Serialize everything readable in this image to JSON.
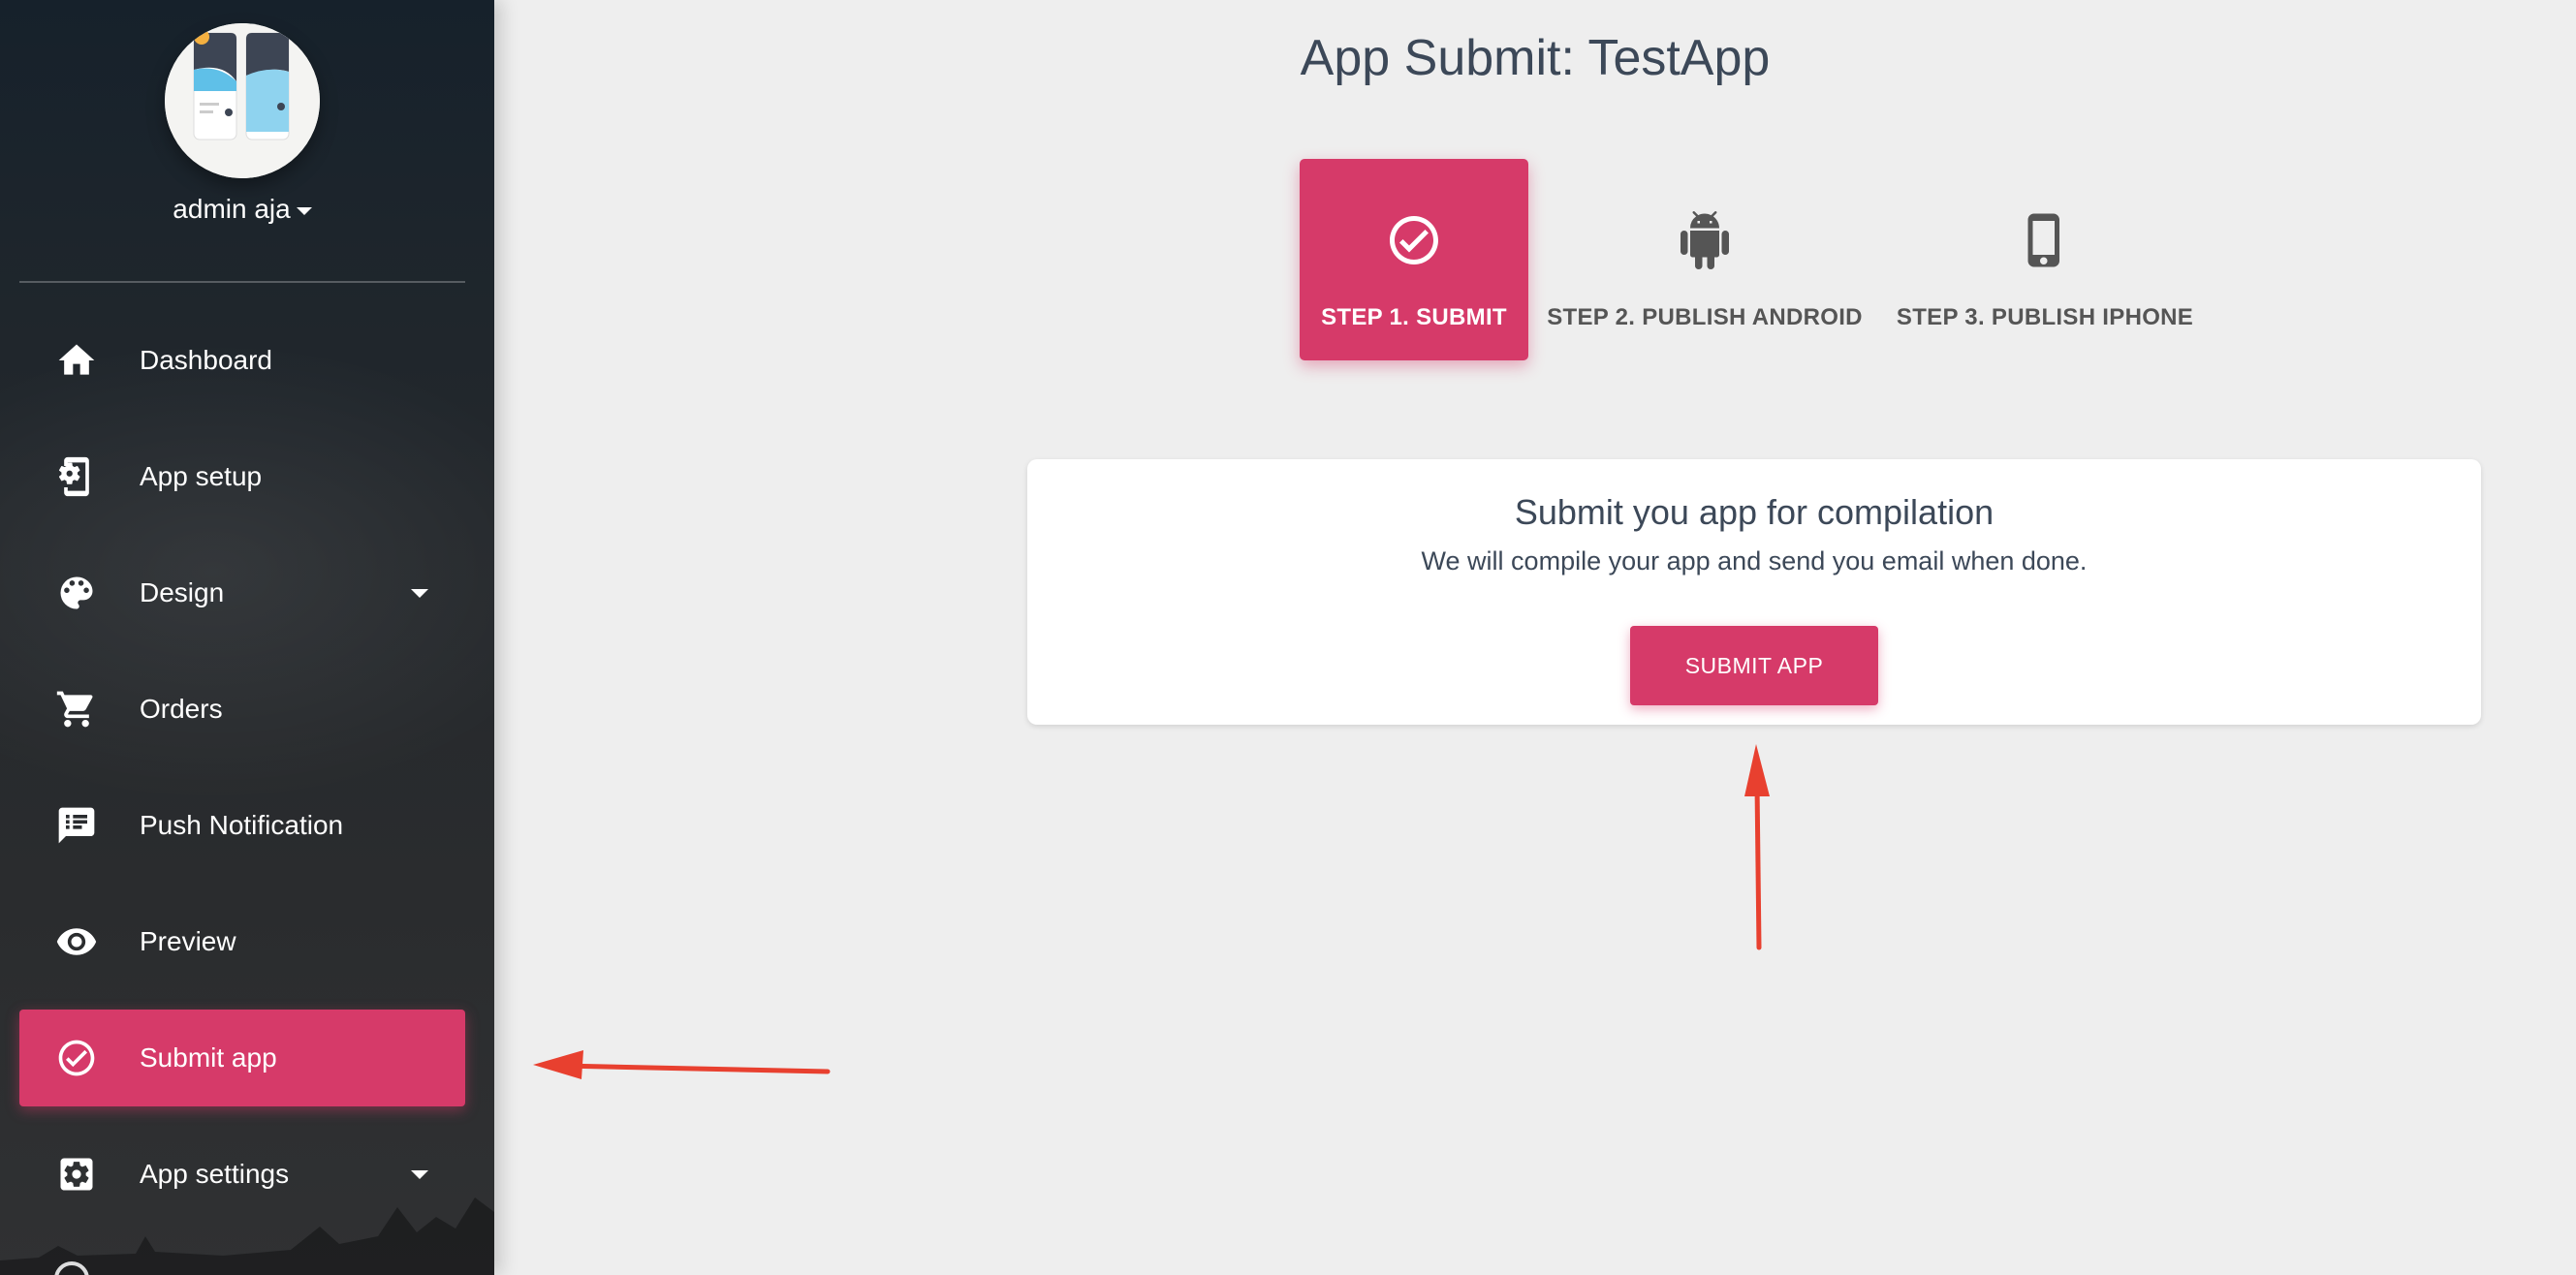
{
  "sidebar": {
    "user_name": "admin aja",
    "items": [
      {
        "label": "Dashboard",
        "icon": "home-icon",
        "dropdown": false,
        "active": false
      },
      {
        "label": "App setup",
        "icon": "phone-settings-icon",
        "dropdown": false,
        "active": false
      },
      {
        "label": "Design",
        "icon": "palette-icon",
        "dropdown": true,
        "active": false
      },
      {
        "label": "Orders",
        "icon": "cart-icon",
        "dropdown": false,
        "active": false
      },
      {
        "label": "Push Notification",
        "icon": "chat-list-icon",
        "dropdown": false,
        "active": false
      },
      {
        "label": "Preview",
        "icon": "eye-icon",
        "dropdown": false,
        "active": false
      },
      {
        "label": "Submit app",
        "icon": "check-circle-icon",
        "dropdown": false,
        "active": true
      },
      {
        "label": "App settings",
        "icon": "gear-icon",
        "dropdown": true,
        "active": false
      }
    ]
  },
  "main": {
    "title": "App Submit: TestApp",
    "steps": [
      {
        "label": "STEP 1. SUBMIT",
        "icon": "check-circle-icon",
        "active": true
      },
      {
        "label": "STEP 2. PUBLISH ANDROID",
        "icon": "android-icon",
        "active": false
      },
      {
        "label": "STEP 3. PUBLISH IPHONE",
        "icon": "smartphone-icon",
        "active": false
      }
    ],
    "card": {
      "title": "Submit you app for compilation",
      "text": "We will compile your app and send you email when done.",
      "button_label": "SUBMIT APP"
    }
  },
  "colors": {
    "accent": "#d63a69",
    "annotation_arrow": "#e8402f",
    "sidebar_bg": "#1d252c",
    "page_bg": "#eeeeee"
  }
}
